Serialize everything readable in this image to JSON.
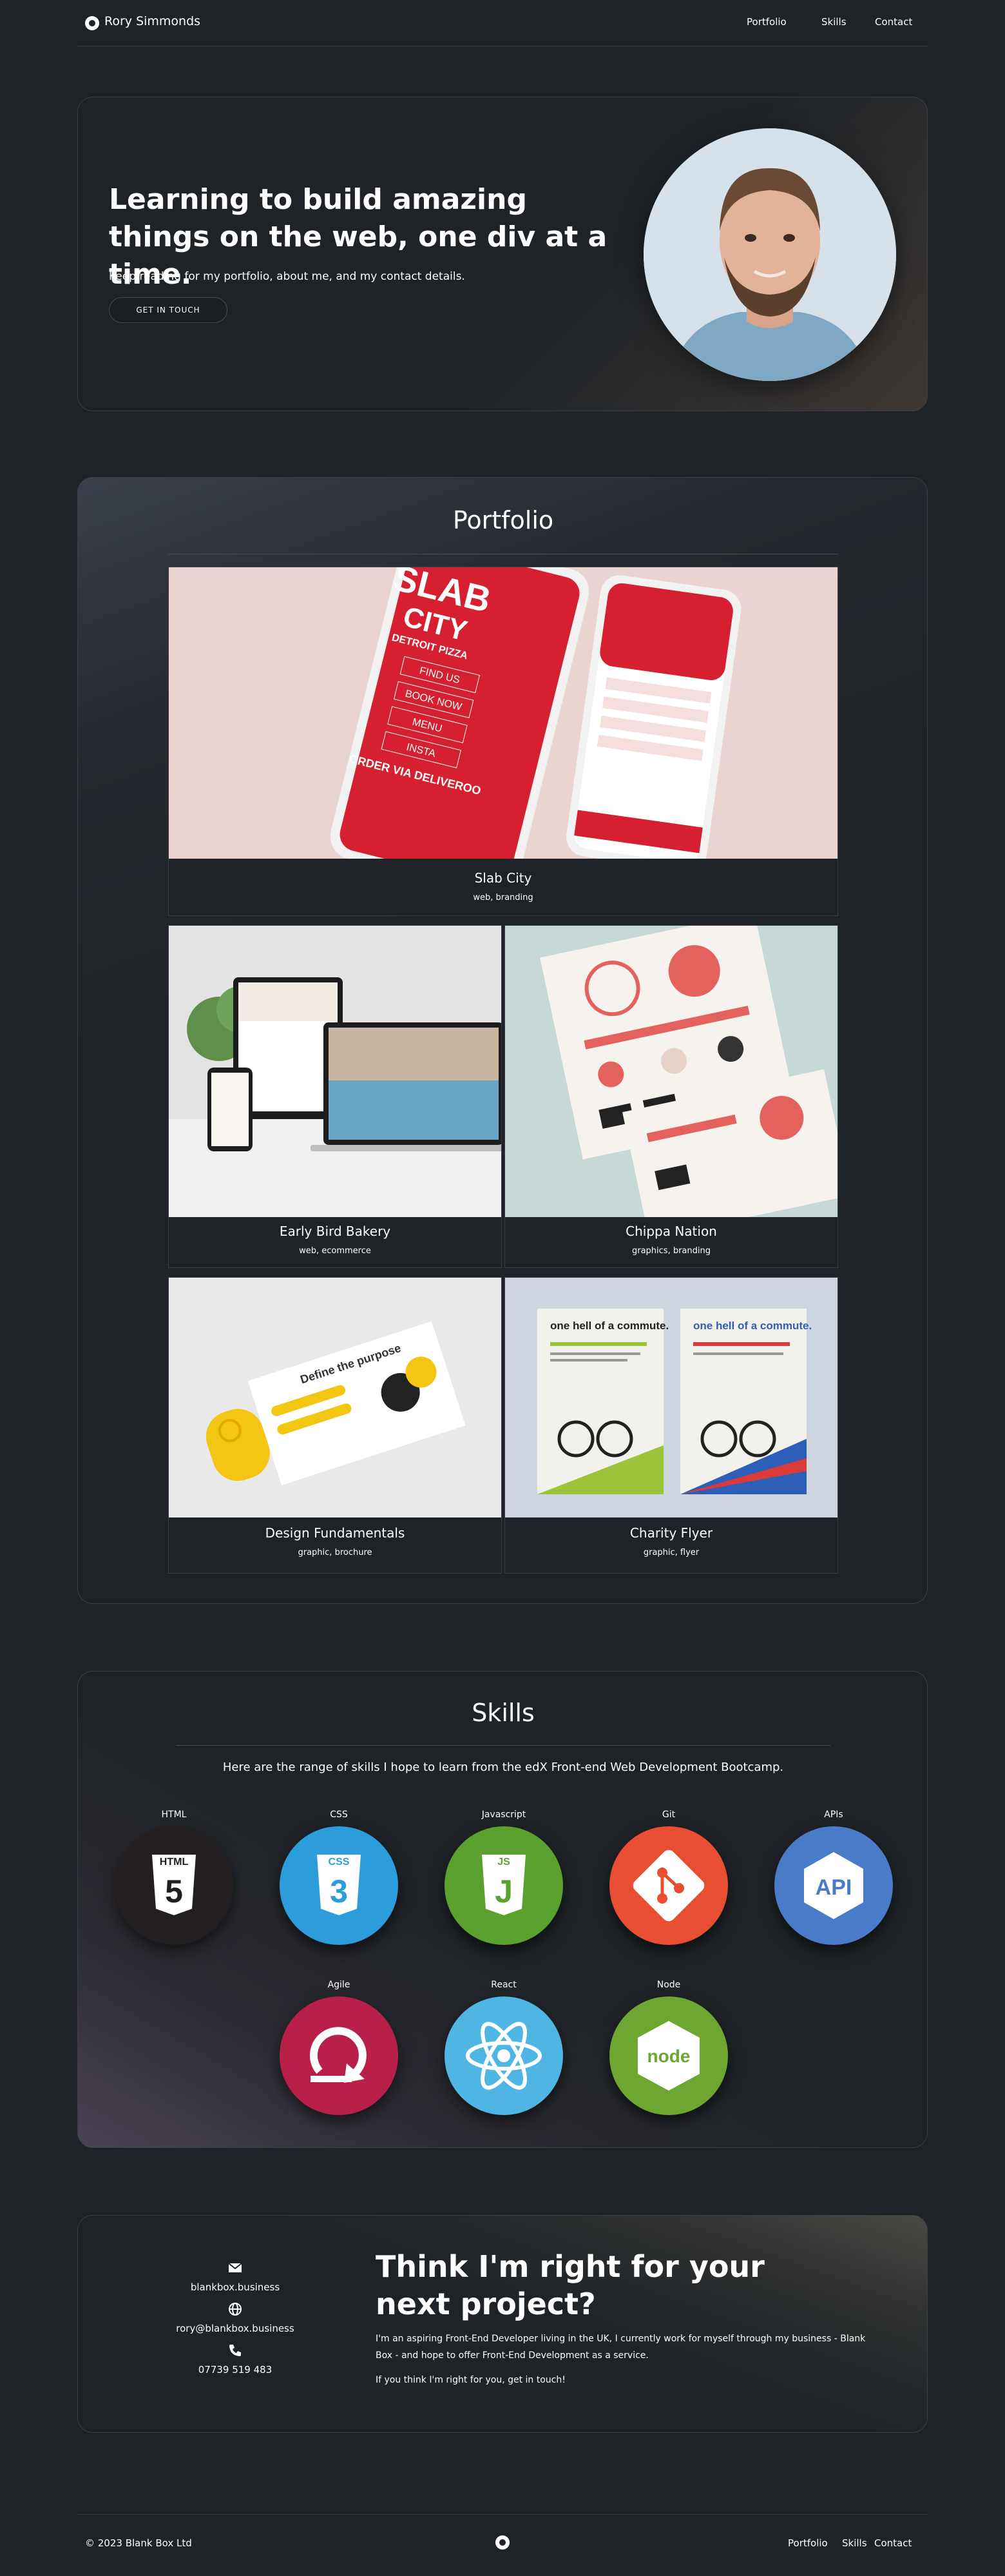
{
  "nav": {
    "brand": "Rory Simmonds",
    "links": [
      "Portfolio",
      "Skills",
      "Contact"
    ]
  },
  "hero": {
    "title": "Learning to build amazing things on the web, one div at a time.",
    "subtitle": "Keep reading for my portfolio, about me, and my contact details.",
    "cta": "GET IN TOUCH"
  },
  "portfolio": {
    "title": "Portfolio",
    "featured": {
      "title": "Slab City",
      "tags": "web, branding",
      "image_text": {
        "brand": "SLAB",
        "brand2": "CITY",
        "sub": "DETROIT PIZZA",
        "menu": [
          "FIND US",
          "BOOK NOW",
          "MENU",
          "INSTA"
        ],
        "order": "ORDER VIA DELIVEROO"
      }
    },
    "items": [
      {
        "title": "Early Bird Bakery",
        "tags": "web, ecommerce"
      },
      {
        "title": "Chippa Nation",
        "tags": "graphics, branding"
      },
      {
        "title": "Design Fundamentals",
        "tags": "graphic, brochure",
        "image_text": "Define the purpose"
      },
      {
        "title": "Charity Flyer",
        "tags": "graphic, flyer",
        "image_text": "one hell of a commute."
      }
    ]
  },
  "skills": {
    "title": "Skills",
    "intro": "Here are the range of skills I hope to learn from the edX Front-end Web Development Bootcamp.",
    "items": [
      {
        "label": "HTML",
        "color": "#231f20",
        "glyph": "5",
        "badge": "HTML"
      },
      {
        "label": "CSS",
        "color": "#2d9cdb",
        "glyph": "3",
        "badge": "CSS"
      },
      {
        "label": "Javascript",
        "color": "#5aa130",
        "glyph": "J",
        "badge": "JS"
      },
      {
        "label": "Git",
        "color": "#e84e31",
        "glyph": "",
        "badge": ""
      },
      {
        "label": "APIs",
        "color": "#4a7bc8",
        "glyph": "API",
        "badge": ""
      },
      {
        "label": "Agile",
        "color": "#b8204a",
        "glyph": "",
        "badge": ""
      },
      {
        "label": "React",
        "color": "#4fb5e2",
        "glyph": "",
        "badge": ""
      },
      {
        "label": "Node",
        "color": "#6ea632",
        "glyph": "node",
        "badge": ""
      }
    ]
  },
  "contact": {
    "website": "blankbox.business",
    "email": "rory@blankbox.business",
    "phone": "07739 519 483",
    "title": "Think I'm right for your next project?",
    "p1": "I'm an aspiring Front-End Developer living in the UK, I currently work for myself through my business - Blank Box - and hope to offer Front-End Development as a service.",
    "p2": "If you think I'm right for you, get in touch!"
  },
  "footer": {
    "copyright": "© 2023 Blank Box Ltd",
    "links": [
      "Portfolio",
      "Skills",
      "Contact"
    ]
  }
}
